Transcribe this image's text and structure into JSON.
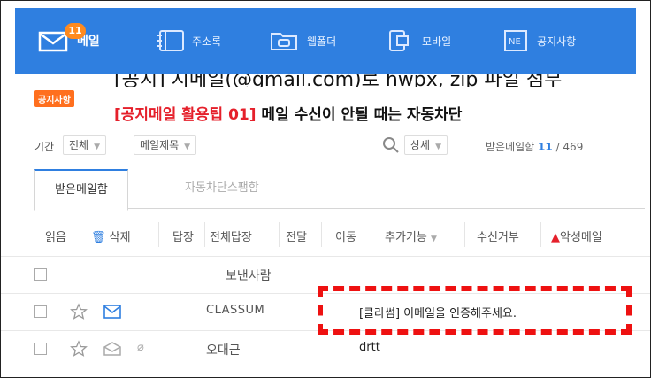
{
  "nav": {
    "mail_badge": "11",
    "items": [
      {
        "label": "메일",
        "icon": "mail-icon"
      },
      {
        "label": "주소록",
        "icon": "address-book-icon"
      },
      {
        "label": "웹폴더",
        "icon": "folder-icon"
      },
      {
        "label": "모바일",
        "icon": "mobile-icon"
      },
      {
        "label": "공지사항",
        "icon": "notice-icon"
      }
    ]
  },
  "notice": {
    "cut_text": "[공지] 지메일(@gmail.com)로 hwpx, zip 파일 첨부",
    "tag": "공지사항",
    "red_text": "[공지메일 활용팁 01]",
    "black_text": " 메일 수신이 안될 때는 자동차단"
  },
  "filter": {
    "period_label": "기간",
    "period_value": "전체",
    "field_value": "메일제목",
    "detail_value": "상세",
    "inbox_label": "받은메일함",
    "unread": "11",
    "total": "/ 469"
  },
  "tabs": [
    {
      "label": "받은메일함",
      "active": true
    },
    {
      "label": "자동차단스팸함",
      "active": false
    }
  ],
  "actions": [
    {
      "label": "읽음"
    },
    {
      "label": "삭제",
      "icon": "trash-icon"
    },
    {
      "label": "답장"
    },
    {
      "label": "전체답장"
    },
    {
      "label": "전달"
    },
    {
      "label": "이동"
    },
    {
      "label": "추가기능",
      "dropdown": true
    },
    {
      "label": "수신거부"
    },
    {
      "label": "악성메일",
      "icon": "warning-icon"
    }
  ],
  "table": {
    "header_sender": "보낸사람",
    "rows": [
      {
        "sender": "CLASSUM",
        "subject": "[클라썸] 이메일을 인증해주세요.",
        "unread": true
      },
      {
        "sender": "오대근",
        "subject": "drtt",
        "unread": false
      }
    ]
  },
  "colors": {
    "accent": "#2f7fe0",
    "notice_tag": "#ff6f1e",
    "badge": "#ff8a1f",
    "highlight": "#ee1111",
    "notice_red": "#e5202b"
  }
}
